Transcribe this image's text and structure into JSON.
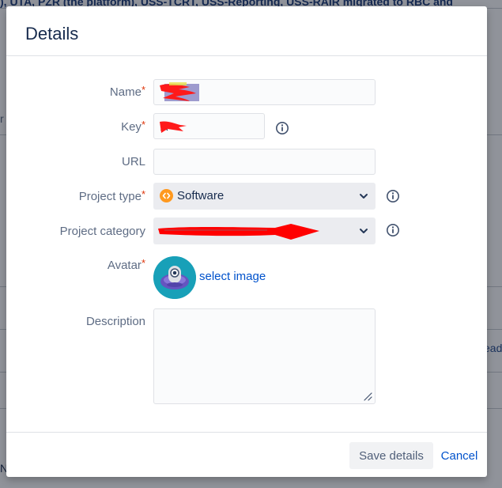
{
  "background": {
    "banner_text": "), UTA, PZR (the platform), USS-TCRT, USS-Reporting, USS-RAIR migrated to RBC and",
    "left_fragment": "r",
    "right_fragment": "ead",
    "bottom_fragment": "N"
  },
  "dialog": {
    "title": "Details"
  },
  "form": {
    "name": {
      "label": "Name",
      "required_mark": "*",
      "value": "",
      "redacted": true
    },
    "key": {
      "label": "Key",
      "required_mark": "*",
      "value": "A",
      "redacted": true
    },
    "url": {
      "label": "URL",
      "value": "",
      "placeholder": ""
    },
    "project_type": {
      "label": "Project type",
      "required_mark": "*",
      "value": "Software",
      "icon": "software-icon"
    },
    "project_category": {
      "label": "Project category",
      "value": "",
      "redacted": true
    },
    "avatar": {
      "label": "Avatar",
      "required_mark": "*",
      "link_text": "select image"
    },
    "description": {
      "label": "Description",
      "value": ""
    }
  },
  "footer": {
    "save_label": "Save details",
    "cancel_label": "Cancel"
  },
  "colors": {
    "accent": "#0052cc",
    "required": "#de350b",
    "redaction": "#ff0000",
    "software_icon": "#ff991f",
    "avatar_bg": "#18a0b8"
  }
}
